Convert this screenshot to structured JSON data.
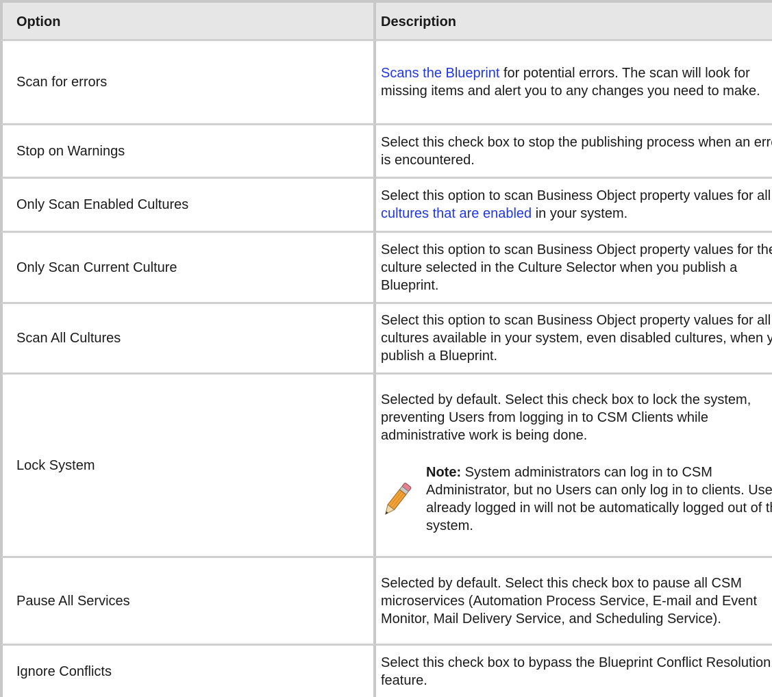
{
  "table": {
    "headers": {
      "option": "Option",
      "description": "Description"
    },
    "rows": [
      {
        "option": "Scan for errors",
        "desc_link": "Scans the Blueprint",
        "desc_rest": " for potential errors. The scan will look for missing items and alert you to any changes you need to make."
      },
      {
        "option": "Stop on Warnings",
        "desc": "Select this check box to stop the publishing process when an error is encountered."
      },
      {
        "option": "Only Scan Enabled Cultures",
        "desc_before": "Select this option to scan Business Object property values for all ",
        "desc_link": "cultures that are enabled",
        "desc_after": " in your system."
      },
      {
        "option": "Only Scan Current Culture",
        "desc": "Select this option to scan Business Object property values for the culture selected in the Culture Selector when you publish a Blueprint."
      },
      {
        "option": "Scan All Cultures",
        "desc": "Select this option to scan Business Object property values for all cultures available in your system, even disabled cultures, when you publish a Blueprint."
      },
      {
        "option": "Lock System",
        "desc": "Selected by default. Select this check box to lock the system, preventing Users from logging in to CSM Clients while administrative work is being done.",
        "note_label": "Note:",
        "note_text": " System administrators can log in to CSM Administrator, but no Users can only log in to clients. Users already logged in will not be automatically logged out of the system."
      },
      {
        "option": "Pause All Services",
        "desc": "Selected by default. Select this check box to pause all CSM microservices (Automation Process Service, E-mail and Event Monitor, Mail Delivery Service, and Scheduling Service)."
      },
      {
        "option": "Ignore Conflicts",
        "desc": "Select this check box to bypass the Blueprint Conflict Resolution feature."
      }
    ]
  },
  "icons": {
    "note": "pencil-icon"
  },
  "colors": {
    "link": "#1f37e6",
    "header_bg": "#e6e6e6",
    "border": "#c8c8c8"
  }
}
